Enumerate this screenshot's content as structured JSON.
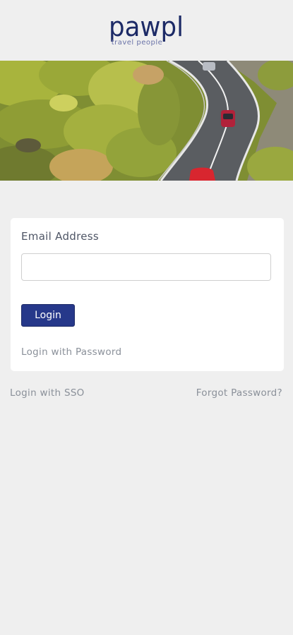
{
  "brand": {
    "name": "pawpl",
    "tagline": "travel people",
    "color": "#1c2a66"
  },
  "hero": {
    "image": "coastal-road-photo"
  },
  "login_form": {
    "email_label": "Email Address",
    "email_value": "",
    "email_placeholder": "",
    "login_button": "Login",
    "login_with_password": "Login with Password",
    "button_color": "#26388a"
  },
  "footer_links": {
    "sso": "Login with SSO",
    "forgot_password": "Forgot Password?"
  }
}
